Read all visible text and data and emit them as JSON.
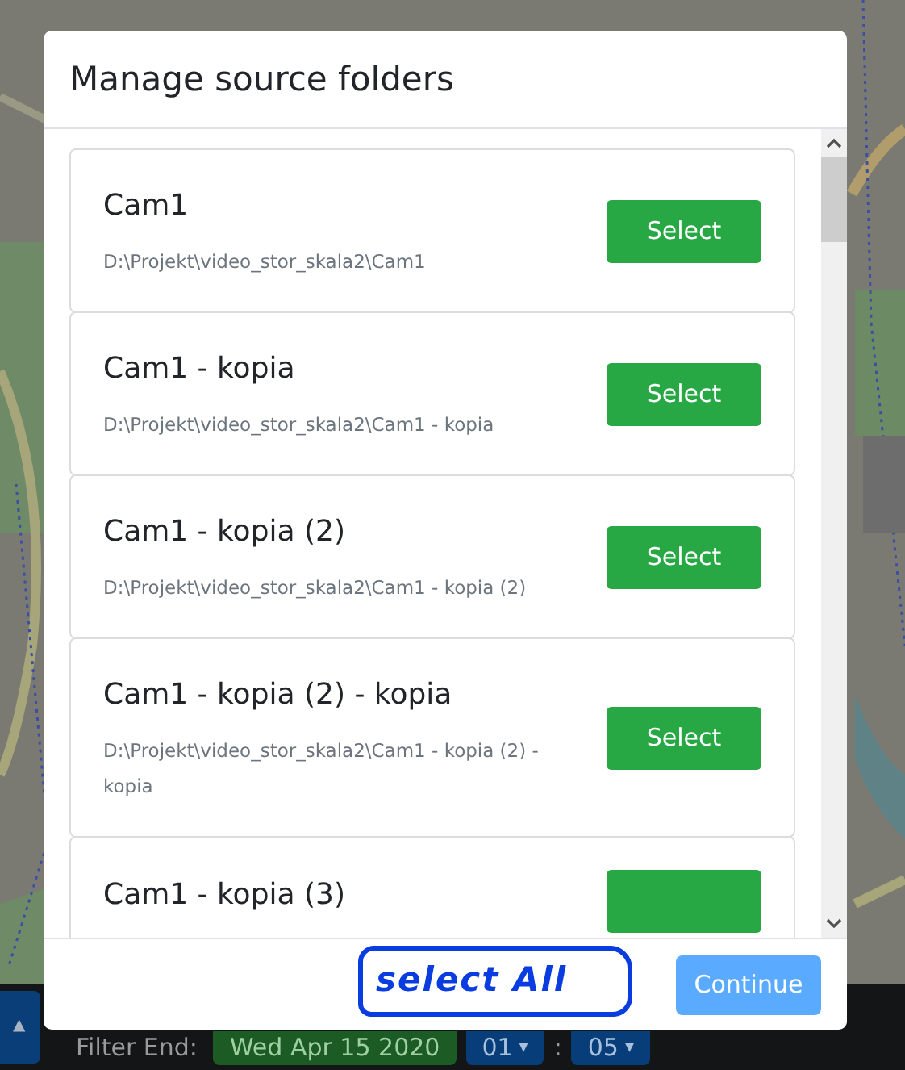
{
  "background_bar": {
    "toggle_caret": "▲",
    "filter_label": "Filter End:",
    "date_button": "Wed Apr 15 2020",
    "hour_button": {
      "label": "01",
      "caret": "▾"
    },
    "separator": ":",
    "minute_button": {
      "label": "05",
      "caret": "▾"
    }
  },
  "modal": {
    "title": "Manage source folders",
    "folders": [
      {
        "name": "Cam1",
        "path": "D:\\Projekt\\video_stor_skala2\\Cam1",
        "button": "Select"
      },
      {
        "name": "Cam1 - kopia",
        "path": "D:\\Projekt\\video_stor_skala2\\Cam1 - kopia",
        "button": "Select"
      },
      {
        "name": "Cam1 - kopia (2)",
        "path": "D:\\Projekt\\video_stor_skala2\\Cam1 - kopia (2)",
        "button": "Select"
      },
      {
        "name": "Cam1 - kopia (2) - kopia",
        "path": "D:\\Projekt\\video_stor_skala2\\Cam1 - kopia (2) - kopia",
        "button": "Select"
      },
      {
        "name": "Cam1 - kopia (3)"
      }
    ],
    "continue_button": {
      "label": "Continue",
      "disabled": true
    }
  },
  "annotation": {
    "text": "select All"
  }
}
